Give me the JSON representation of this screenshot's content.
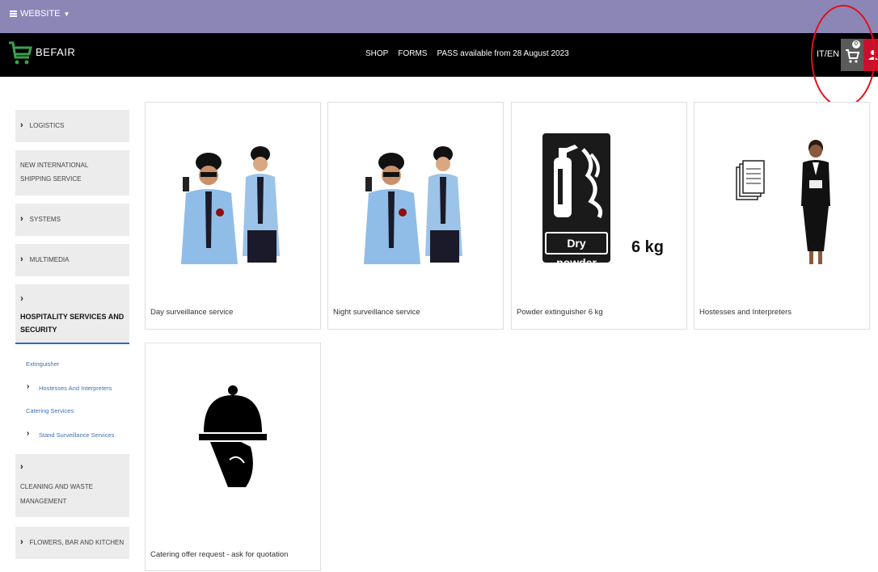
{
  "topbar": {
    "website_label": "WEBSITE"
  },
  "header": {
    "logo_text": "BEFAIR",
    "nav": [
      "SHOP",
      "FORMS",
      "PASS available from 28 August 2023"
    ],
    "lang": "IT/EN",
    "cart_count": "0"
  },
  "sidebar": {
    "logistics": "LOGISTICS",
    "shipping": "NEW INTERNATIONAL SHIPPING SERVICE",
    "systems": "SYSTEMS",
    "multimedia": "MULTIMEDIA",
    "hospitality": "HOSPITALITY SERVICES AND SECURITY",
    "sub": {
      "extinguisher": "Extinguisher",
      "hostesses": "Hostesses And Interpreters",
      "catering": "Catering Services",
      "stand": "Stand Surveillance Services"
    },
    "cleaning": "CLEANING AND WASTE MANAGEMENT",
    "flowers": "FLOWERS, BAR AND KITCHEN"
  },
  "products": [
    {
      "name": "Day surveillance service"
    },
    {
      "name": "Night surveillance service"
    },
    {
      "name": "Powder extinguisher 6 kg",
      "label": "Dry powder",
      "weight": "6 kg"
    },
    {
      "name": "Hostesses and Interpreters"
    },
    {
      "name": "Catering offer request - ask for quotation"
    }
  ],
  "colors": {
    "topbar": "#8c86b6",
    "header": "#000000",
    "accent_red": "#c8102e",
    "link": "#4070b0"
  }
}
